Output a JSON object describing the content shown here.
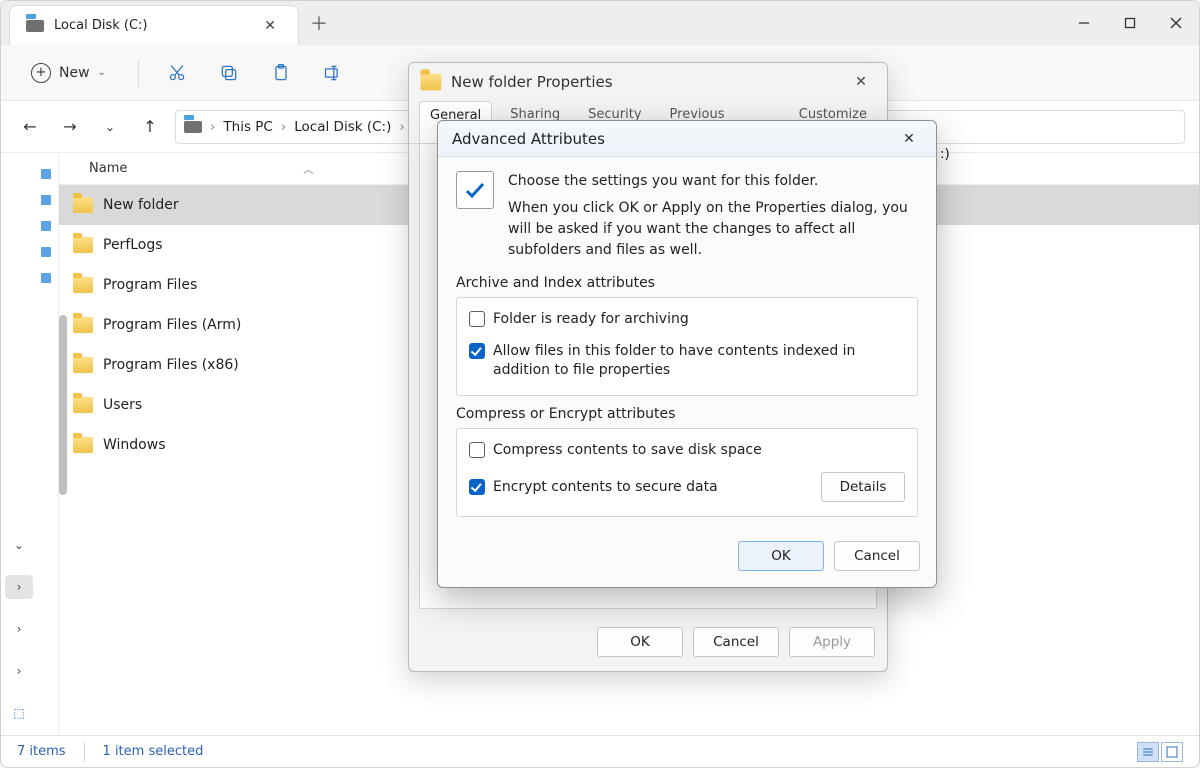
{
  "tab": {
    "title": "Local Disk (C:)"
  },
  "toolbar": {
    "new_label": "New"
  },
  "breadcrumb": {
    "thispc": "This PC",
    "drive": "Local Disk (C:)",
    "clipped": ":)"
  },
  "columns": {
    "name": "Name"
  },
  "folders": [
    {
      "name": "New folder",
      "selected": true
    },
    {
      "name": "PerfLogs",
      "selected": false
    },
    {
      "name": "Program Files",
      "selected": false
    },
    {
      "name": "Program Files (Arm)",
      "selected": false
    },
    {
      "name": "Program Files (x86)",
      "selected": false
    },
    {
      "name": "Users",
      "selected": false
    },
    {
      "name": "Windows",
      "selected": false
    }
  ],
  "status": {
    "count": "7 items",
    "selection": "1 item selected"
  },
  "props": {
    "title": "New folder Properties",
    "tabs": [
      "General",
      "Sharing",
      "Security",
      "Previous Versions",
      "Customize"
    ],
    "buttons": {
      "ok": "OK",
      "cancel": "Cancel",
      "apply": "Apply"
    }
  },
  "adv": {
    "title": "Advanced Attributes",
    "intro1": "Choose the settings you want for this folder.",
    "intro2": "When you click OK or Apply on the Properties dialog, you will be asked if you want the changes to affect all subfolders and files as well.",
    "group1_label": "Archive and Index attributes",
    "archive": "Folder is ready for archiving",
    "index": "Allow files in this folder to have contents indexed in addition to file properties",
    "group2_label": "Compress or Encrypt attributes",
    "compress": "Compress contents to save disk space",
    "encrypt": "Encrypt contents to secure data",
    "details": "Details",
    "ok": "OK",
    "cancel": "Cancel"
  }
}
